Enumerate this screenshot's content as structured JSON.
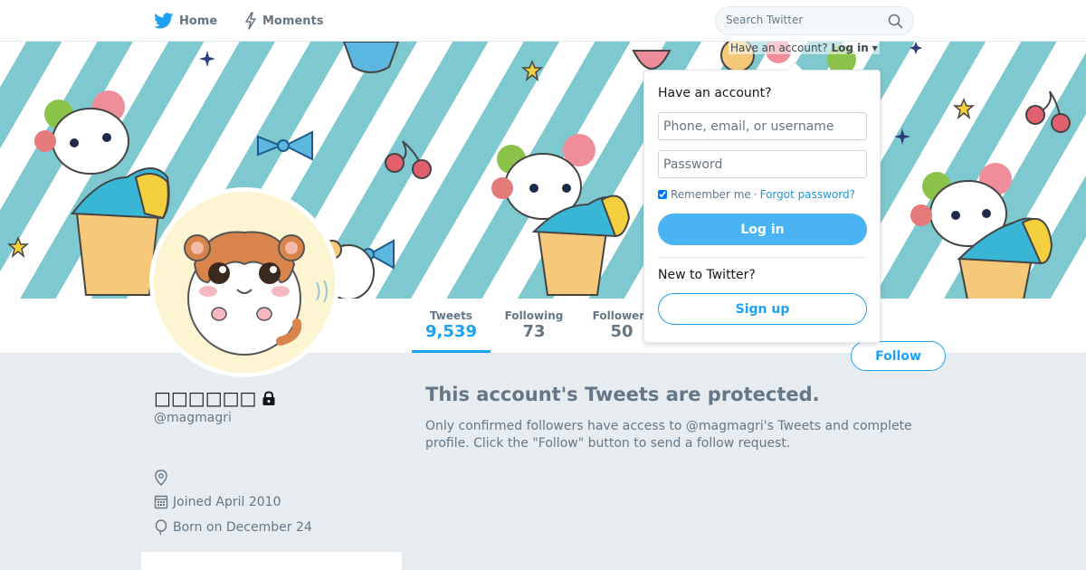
{
  "nav": {
    "home_label": "Home",
    "moments_label": "Moments",
    "home_icon": "twitter-bird-icon",
    "moments_icon": "lightning-icon"
  },
  "search": {
    "placeholder": "Search Twitter",
    "icon": "search-icon"
  },
  "account_menu": {
    "prompt": "Have an account?",
    "login_label": "Log in"
  },
  "login_dropdown": {
    "title": "Have an account?",
    "username_placeholder": "Phone, email, or username",
    "password_placeholder": "Password",
    "remember_label": "Remember me",
    "separator": "·",
    "forgot_label": "Forgot password?",
    "login_button": "Log in",
    "new_prompt": "New to Twitter?",
    "signup_button": "Sign up"
  },
  "profile": {
    "name": "□□□□□□",
    "handle": "@magmagri",
    "joined": "Joined April 2010",
    "born": "Born on December 24",
    "location": "",
    "protected_icon": "lock-icon"
  },
  "stats": [
    {
      "label": "Tweets",
      "value": "9,539"
    },
    {
      "label": "Following",
      "value": "73"
    },
    {
      "label": "Followers",
      "value": "50"
    }
  ],
  "follow_button": "Follow",
  "protected": {
    "title": "This account's Tweets are protected.",
    "body": "Only confirmed followers have access to @magmagri's Tweets and complete profile. Click the \"Follow\" button to send a follow request."
  },
  "colors": {
    "brand": "#1da1f2",
    "login_button": "#4ab3f4",
    "background": "#e6ecf0",
    "banner_stripe": "#7ec8cf"
  }
}
